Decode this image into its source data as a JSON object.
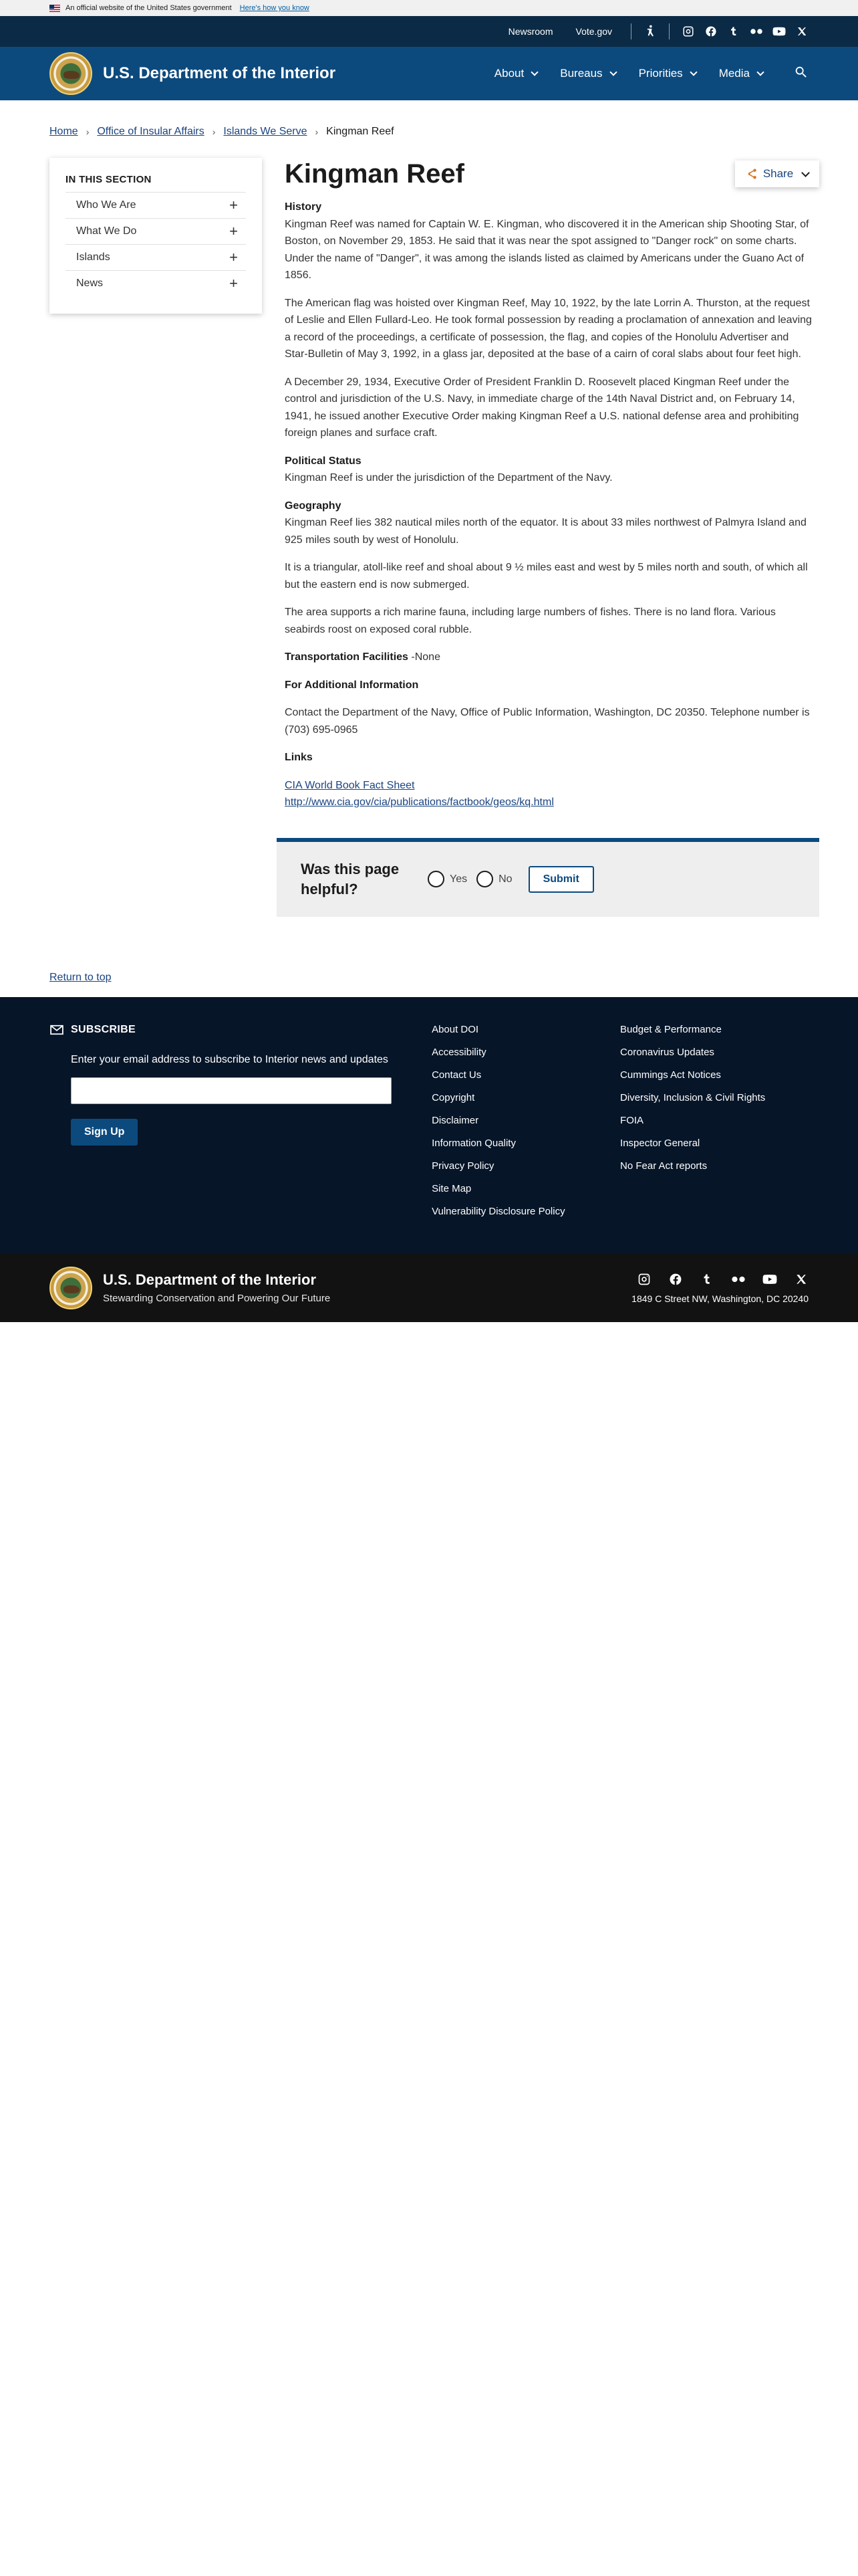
{
  "gov_banner": {
    "text": "An official website of the United States government",
    "link": "Here's how you know"
  },
  "utility": {
    "links": [
      "Newsroom",
      "Vote.gov"
    ],
    "icons": [
      "accessibility-icon",
      "instagram-icon",
      "facebook-icon",
      "tumblr-icon",
      "flickr-icon",
      "youtube-icon",
      "x-icon"
    ]
  },
  "header": {
    "title": "U.S. Department of the Interior",
    "nav": [
      "About",
      "Bureaus",
      "Priorities",
      "Media"
    ]
  },
  "breadcrumb": [
    "Home",
    "Office of Insular Affairs",
    "Islands We Serve",
    "Kingman Reef"
  ],
  "sidebar": {
    "title": "IN THIS SECTION",
    "items": [
      "Who We Are",
      "What We Do",
      "Islands",
      "News"
    ]
  },
  "page": {
    "title": "Kingman Reef",
    "share_label": "Share"
  },
  "content": {
    "h_history": "History",
    "p1": "Kingman Reef was named for Captain W. E. Kingman, who discovered it in the American ship Shooting Star, of Boston, on November 29, 1853. He said that it was near the spot assigned to \"Danger rock\" on some charts. Under the name of \"Danger\", it was among the islands listed as claimed by Americans under the Guano Act of 1856.",
    "p2": "The American flag was hoisted over Kingman Reef, May 10, 1922, by the late Lorrin A. Thurston, at the request of Leslie and Ellen Fullard-Leo. He took formal possession by reading a proclamation of annexation and leaving a record of the proceedings, a certificate of possession, the flag, and copies of the Honolulu Advertiser and Star-Bulletin of May 3, 1992, in a glass jar, deposited at the base of a cairn of coral slabs about four feet high.",
    "p3": "A December 29, 1934, Executive Order of President Franklin D. Roosevelt placed Kingman Reef under the control and jurisdiction of the U.S. Navy, in immediate charge of the 14th Naval District and, on February 14, 1941, he issued another Executive Order making Kingman Reef a U.S. national defense area and prohibiting foreign planes and surface craft.",
    "h_political": "Political Status",
    "p4": "Kingman Reef is under the jurisdiction of the Department of the Navy.",
    "h_geography": "Geography",
    "p5": "Kingman Reef lies 382 nautical miles north of the equator. It is about 33 miles northwest of Palmyra Island and 925 miles south by west of Honolulu.",
    "p6": "It is a triangular, atoll-like reef and shoal about 9 ½ miles east and west by 5 miles north and south, of which all but the eastern end is now submerged.",
    "p7": "The area supports a rich marine fauna, including large numbers of fishes. There is no land flora. Various seabirds roost on exposed coral rubble.",
    "h_transport": "Transportation Facilities",
    "transport_value": " -None",
    "h_additional": "For Additional Information",
    "p8": "Contact the Department of the Navy, Office of Public Information, Washington, DC 20350. Telephone number is (703) 695-0965",
    "h_links": "Links",
    "link1": "CIA World Book Fact Sheet",
    "link2": "http://www.cia.gov/cia/publications/factbook/geos/kq.html"
  },
  "feedback": {
    "question": "Was this page helpful?",
    "yes": "Yes",
    "no": "No",
    "submit": "Submit"
  },
  "return_to_top": "Return to top",
  "footer": {
    "subscribe_title": "SUBSCRIBE",
    "subscribe_text": "Enter your email address to subscribe to Interior news and updates",
    "signup_label": "Sign Up",
    "links_col1": [
      "About DOI",
      "Accessibility",
      "Contact Us",
      "Copyright",
      "Disclaimer",
      "Information Quality",
      "Privacy Policy",
      "Site Map",
      "Vulnerability Disclosure Policy"
    ],
    "links_col2": [
      "Budget & Performance",
      "Coronavirus Updates",
      "Cummings Act Notices",
      "Diversity, Inclusion & Civil Rights",
      "FOIA",
      "Inspector General",
      "No Fear Act reports"
    ]
  },
  "bottom": {
    "title": "U.S. Department of the Interior",
    "subtitle": "Stewarding Conservation and Powering Our Future",
    "address": "1849 C Street NW, Washington, DC 20240"
  }
}
